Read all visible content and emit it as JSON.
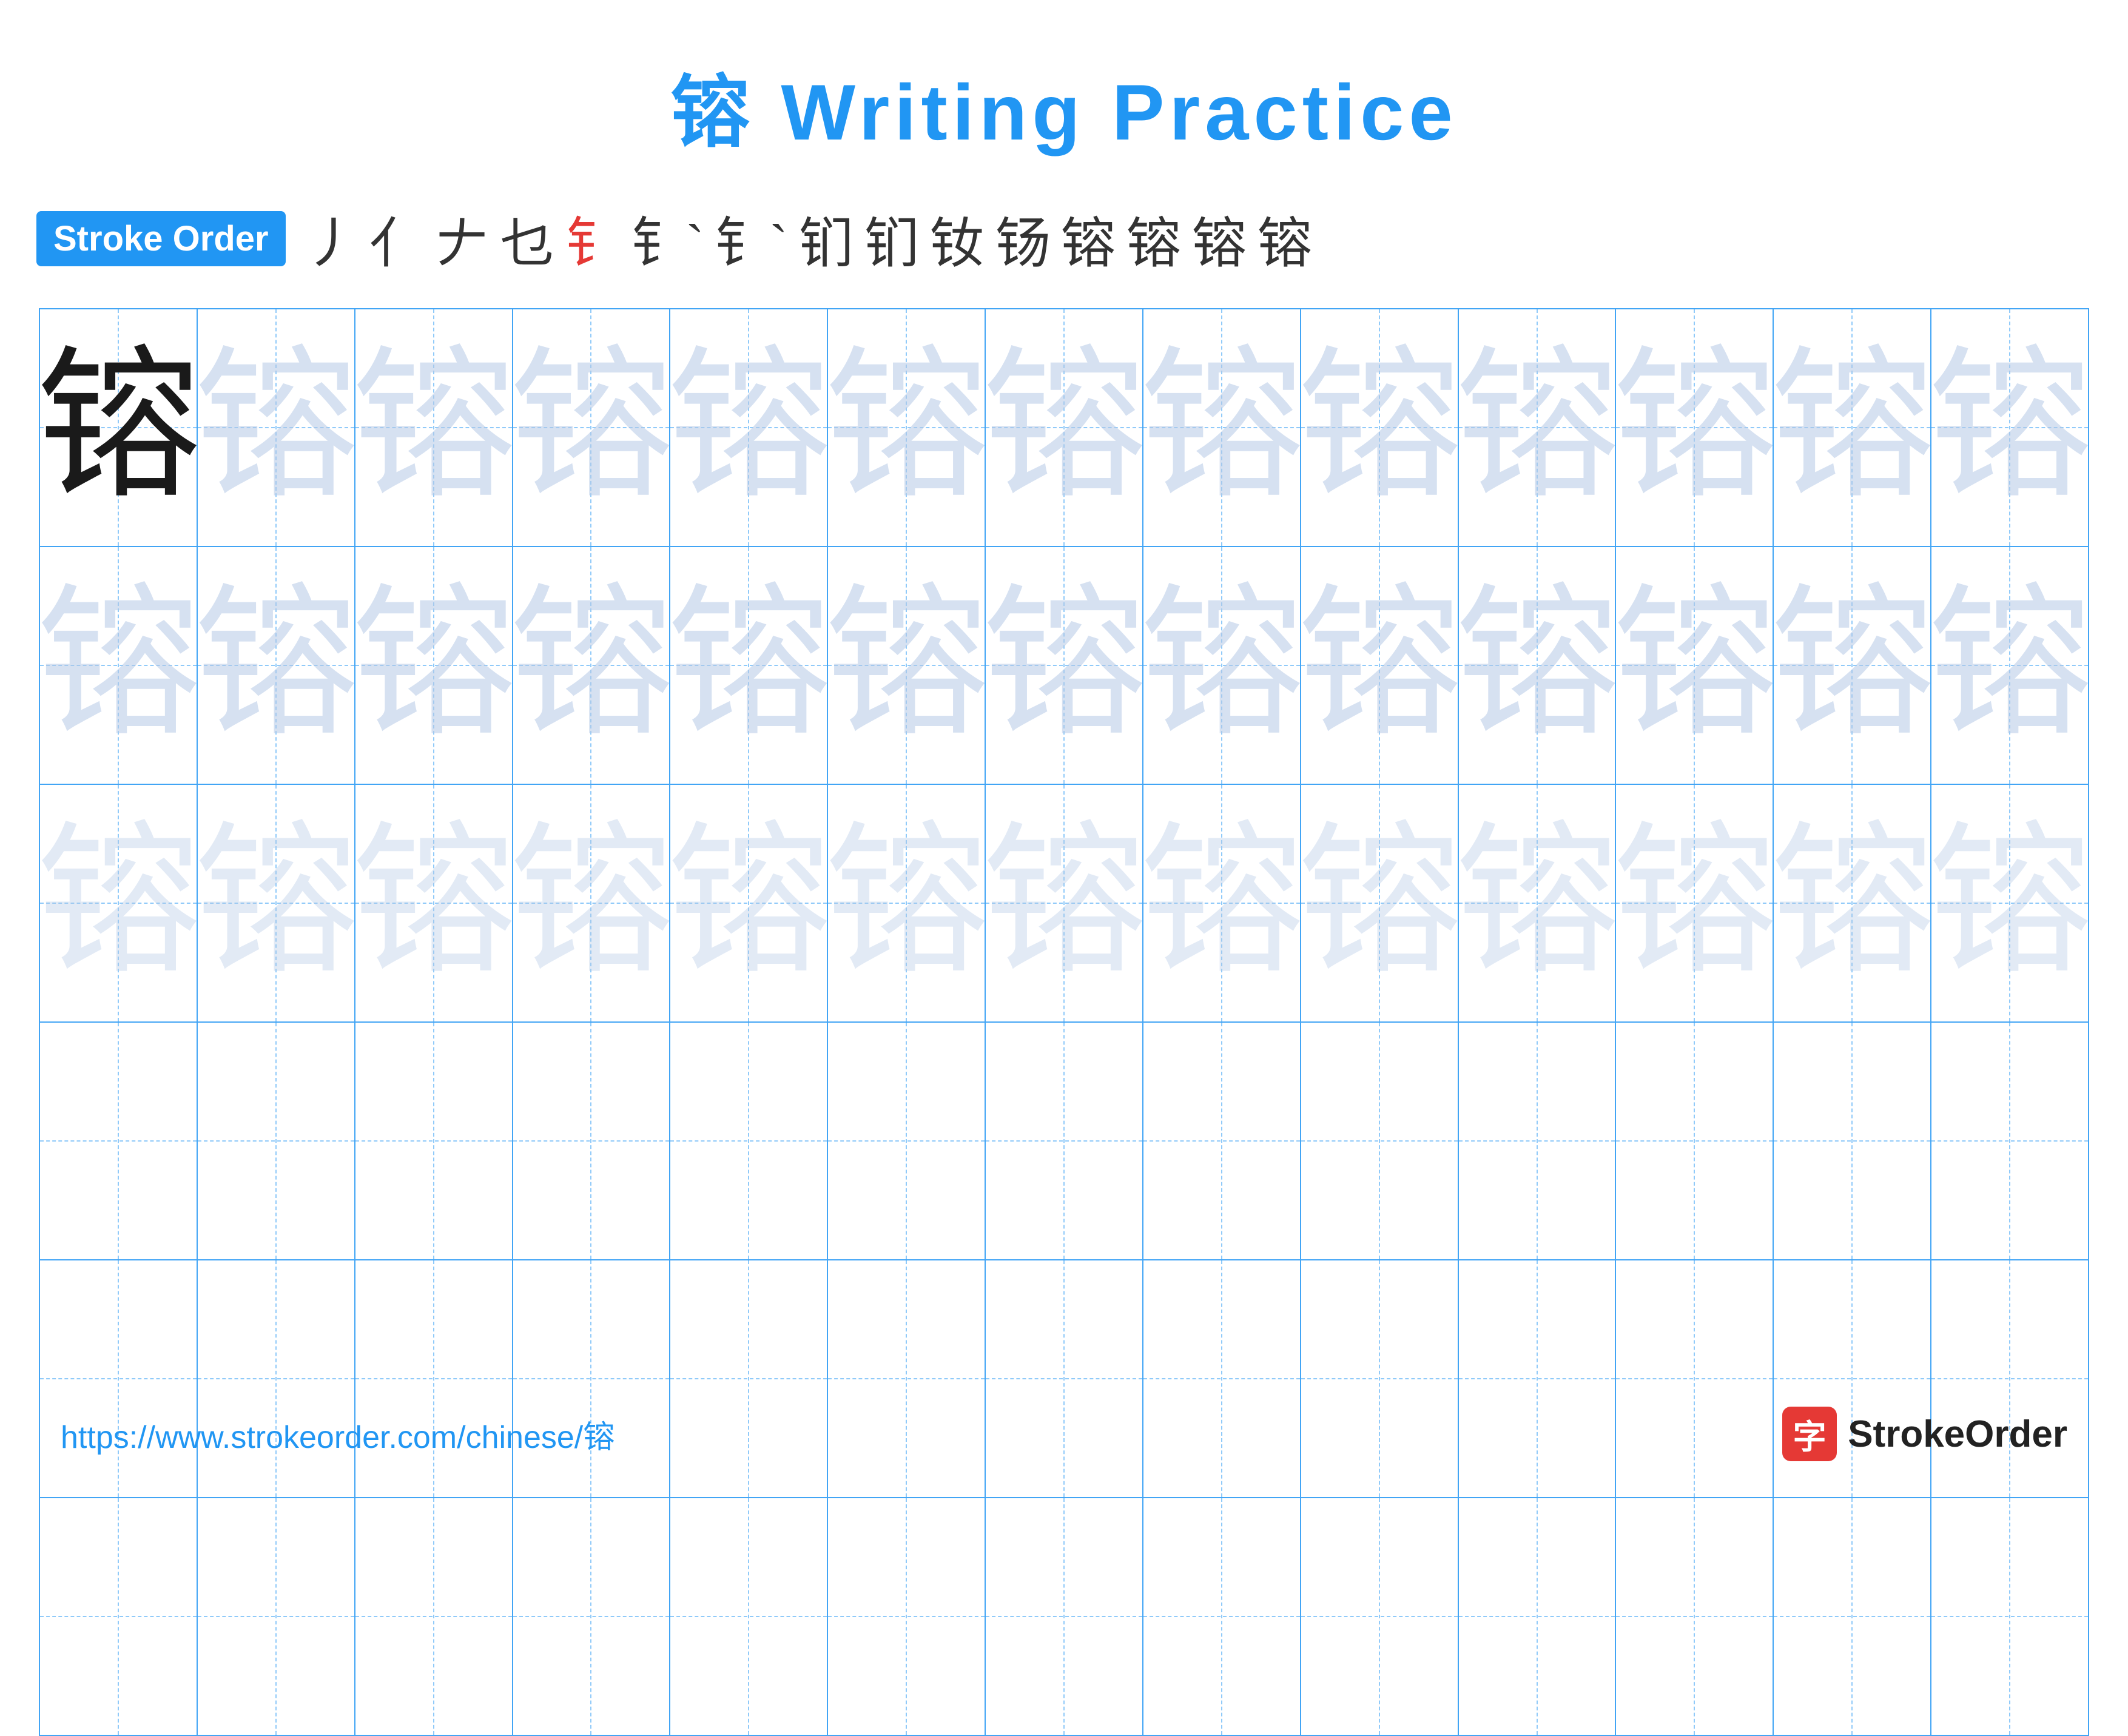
{
  "title": {
    "text": "镕 Writing Practice",
    "color": "#2196F3"
  },
  "stroke_order": {
    "badge_label": "Stroke Order",
    "strokes": [
      "丿",
      "亻",
      "ㄥ",
      "乜",
      "钅",
      "钅`",
      "钅`",
      "钔",
      "钔",
      "钕",
      "钖",
      "镕",
      "镕",
      "镕",
      "镕"
    ]
  },
  "character": "镕",
  "grid": {
    "rows": 6,
    "cols": 13,
    "filled_rows": 3,
    "empty_rows": 3
  },
  "footer": {
    "url": "https://www.strokeorder.com/chinese/镕",
    "logo_text": "StrokeOrder",
    "logo_icon": "字"
  }
}
